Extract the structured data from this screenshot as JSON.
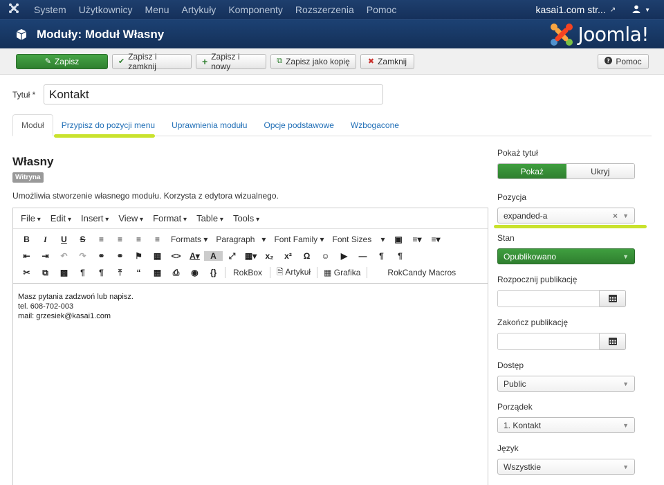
{
  "topbar": {
    "menu": [
      "System",
      "Użytkownicy",
      "Menu",
      "Artykuły",
      "Komponenty",
      "Rozszerzenia",
      "Pomoc"
    ],
    "site_label": "kasai1.com str..."
  },
  "header": {
    "title": "Moduły: Moduł Własny",
    "brand": "Joomla!"
  },
  "toolbar": {
    "save": "Zapisz",
    "save_close": "Zapisz i zamknij",
    "save_new": "Zapisz i nowy",
    "save_copy": "Zapisz jako kopię",
    "close": "Zamknij",
    "help": "Pomoc"
  },
  "form": {
    "title_label": "Tytuł *",
    "title_value": "Kontakt"
  },
  "tabs": [
    "Moduł",
    "Przypisz do pozycji menu",
    "Uprawnienia modułu",
    "Opcje podstawowe",
    "Wzbogacone"
  ],
  "module": {
    "heading": "Własny",
    "badge": "Witryna",
    "description": "Umożliwia stworzenie własnego modułu. Korzysta z edytora wizualnego."
  },
  "editor": {
    "menu": [
      "File",
      "Edit",
      "Insert",
      "View",
      "Format",
      "Table",
      "Tools"
    ],
    "dropdowns": {
      "formats": "Formats",
      "paragraph": "Paragraph",
      "font_family": "Font Family",
      "font_sizes": "Font Sizes"
    },
    "buttons": {
      "rokbox": "RokBox",
      "article": "Artykuł",
      "image": "Grafika",
      "rokcandy": "RokCandy Macros"
    },
    "content_lines": [
      "Masz pytania zadzwoń lub napisz.",
      "tel. 608-702-003",
      "mail: grzesiek@kasai1.com"
    ]
  },
  "sidebar": {
    "show_title_label": "Pokaż tytuł",
    "show_option": "Pokaż",
    "hide_option": "Ukryj",
    "position_label": "Pozycja",
    "position_value": "expanded-a",
    "state_label": "Stan",
    "state_value": "Opublikowano",
    "publish_up_label": "Rozpocznij publikację",
    "publish_down_label": "Zakończ publikację",
    "access_label": "Dostęp",
    "access_value": "Public",
    "ordering_label": "Porządek",
    "ordering_value": "1. Kontakt",
    "language_label": "Język",
    "language_value": "Wszystkie"
  },
  "colors": {
    "nav": "#1a3867",
    "green": "#2f7f2f",
    "link": "#1f6eb6",
    "highlight": "#c9e22d"
  }
}
